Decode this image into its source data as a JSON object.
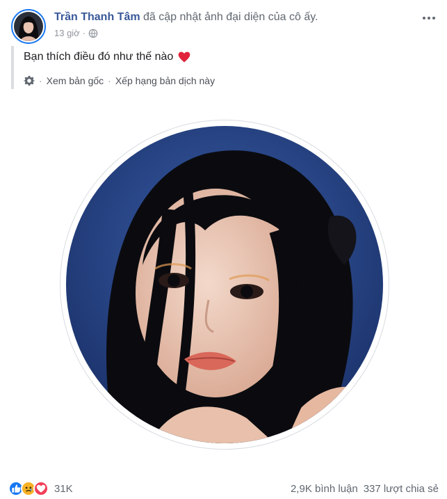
{
  "post": {
    "author_name": "Trần Thanh Tâm",
    "action_text": "đã cập nhật ảnh đại diện của cô ấy.",
    "time": "13 giờ",
    "time_separator": "·",
    "privacy_icon": "globe-icon",
    "caption": "Bạn thích điều đó như thế nào",
    "caption_emoji": "heart-icon",
    "see_original_label": "Xem bản gốc",
    "translate_separator": "·",
    "rate_translation_label": "Xếp hạng bản dịch này"
  },
  "footer": {
    "reaction_icons": [
      "like-icon",
      "sad-icon",
      "love-icon"
    ],
    "reaction_count": "31K",
    "comments": "2,9K bình luận",
    "shares": "337 lượt chia sẻ"
  },
  "colors": {
    "author": "#385898",
    "muted": "#606770",
    "like": "#1877f2",
    "love": "#f33e58",
    "sad": "#f7b125",
    "photo_bg": "#1e3a78"
  }
}
